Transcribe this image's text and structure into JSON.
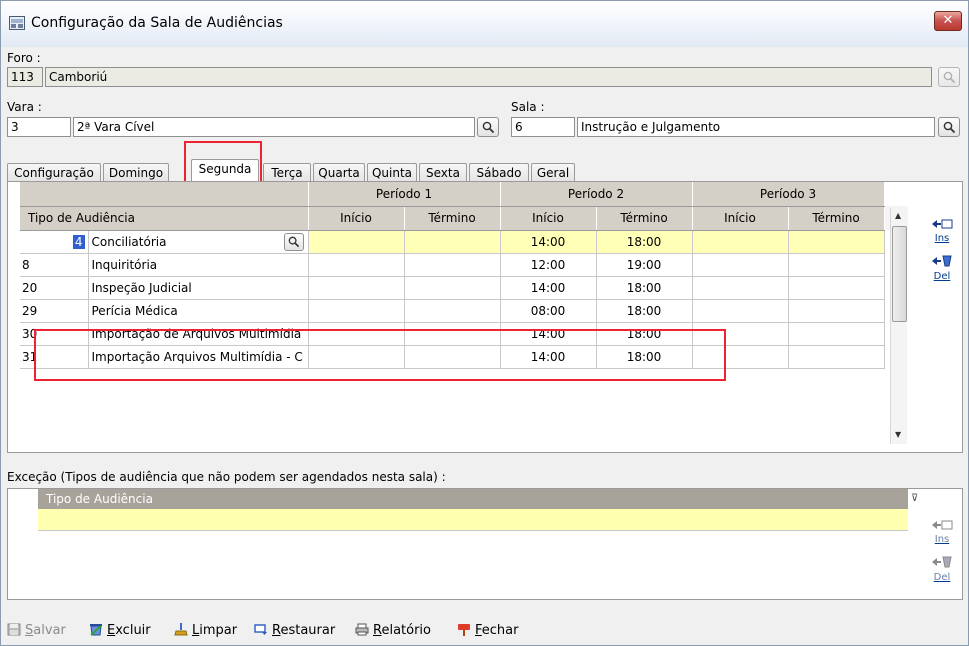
{
  "window": {
    "title": "Configuração da Sala de Audiências"
  },
  "foro": {
    "label": "Foro :",
    "code": "113",
    "name": "Camboriú"
  },
  "vara": {
    "label": "Vara :",
    "code": "3",
    "name": "2ª Vara Cível"
  },
  "sala": {
    "label": "Sala :",
    "code": "6",
    "name": "Instrução e Julgamento"
  },
  "tabs": [
    {
      "label": "Configuração"
    },
    {
      "label": "Domingo"
    },
    {
      "label": "Segunda"
    },
    {
      "label": "Terça"
    },
    {
      "label": "Quarta"
    },
    {
      "label": "Quinta"
    },
    {
      "label": "Sexta"
    },
    {
      "label": "Sábado"
    },
    {
      "label": "Geral"
    }
  ],
  "grid": {
    "group_headers": [
      "Período 1",
      "Período 2",
      "Período 3"
    ],
    "col_first": "Tipo de Audiência",
    "col_inicio": "Início",
    "col_termino": "Término",
    "rows": [
      {
        "code": "4",
        "name": "Conciliatória",
        "p1i": "",
        "p1t": "",
        "p2i": "14:00",
        "p2t": "18:00",
        "p3i": "",
        "p3t": ""
      },
      {
        "code": "8",
        "name": "Inquiritória",
        "p1i": "",
        "p1t": "",
        "p2i": "12:00",
        "p2t": "19:00",
        "p3i": "",
        "p3t": ""
      },
      {
        "code": "20",
        "name": "Inspeção Judicial",
        "p1i": "",
        "p1t": "",
        "p2i": "14:00",
        "p2t": "18:00",
        "p3i": "",
        "p3t": ""
      },
      {
        "code": "29",
        "name": "Perícia Médica",
        "p1i": "",
        "p1t": "",
        "p2i": "08:00",
        "p2t": "18:00",
        "p3i": "",
        "p3t": ""
      },
      {
        "code": "30",
        "name": "Importação de Arquivos Multimídia",
        "p1i": "",
        "p1t": "",
        "p2i": "14:00",
        "p2t": "18:00",
        "p3i": "",
        "p3t": ""
      },
      {
        "code": "31",
        "name": "Importação Arquivos Multimídia - C",
        "p1i": "",
        "p1t": "",
        "p2i": "14:00",
        "p2t": "18:00",
        "p3i": "",
        "p3t": ""
      }
    ],
    "ins_label": "Ins",
    "del_label": "Del"
  },
  "excecao": {
    "label": "Exceção (Tipos de audiência que não podem ser agendados nesta sala) :",
    "col_header": "Tipo de Audiência",
    "ins_label": "Ins",
    "del_label": "Del"
  },
  "footer": {
    "salvar": {
      "first": "S",
      "rest": "alvar"
    },
    "excluir": {
      "first": "E",
      "rest": "xcluir"
    },
    "limpar": {
      "first": "L",
      "rest": "impar"
    },
    "restaurar": {
      "first": "R",
      "rest": "estaurar"
    },
    "relatorio": {
      "first": "R",
      "rest": "elatório"
    },
    "fechar": {
      "first": "F",
      "rest": "echar"
    }
  },
  "colors": {
    "highlight": "#e22233",
    "selected_row": "#ffffb8",
    "header": "#d4d0c8"
  }
}
